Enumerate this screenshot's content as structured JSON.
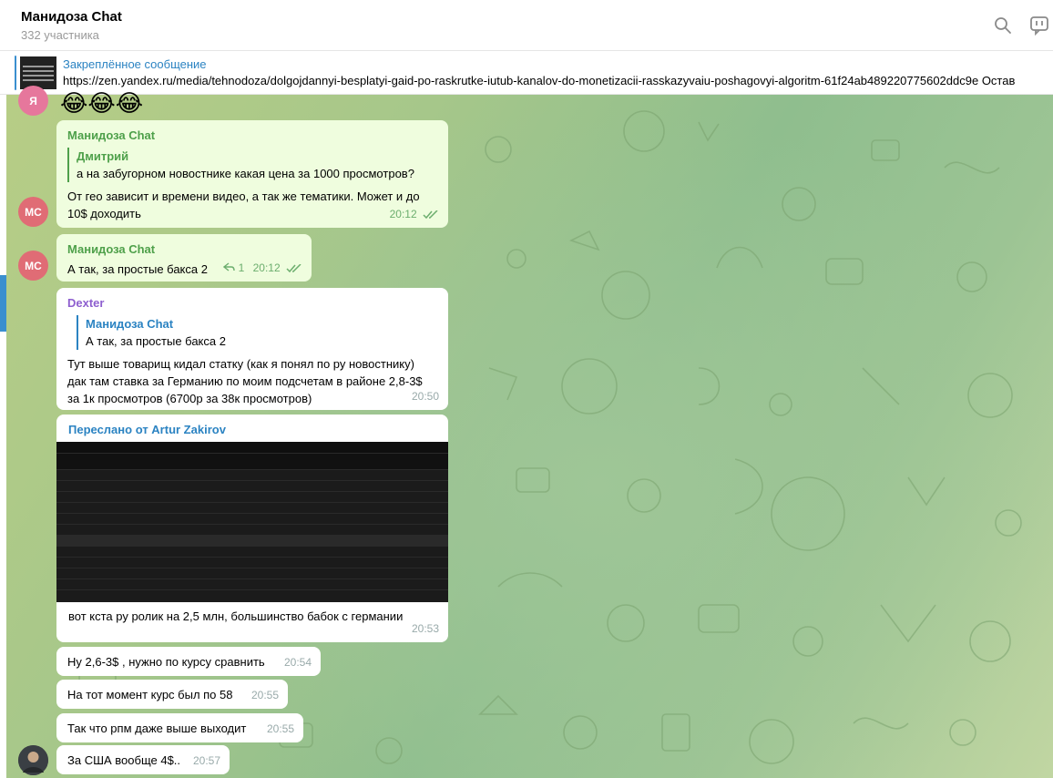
{
  "header": {
    "title": "Манидоза Chat",
    "members": "332 участника"
  },
  "pinned": {
    "title": "Закреплённое сообщение",
    "text": "https://zen.yandex.ru/media/tehnodoza/dolgojdannyi-besplatyi-gaid-po-raskrutke-iutub-kanalov-do-monetizacii-rasskazyvaiu-poshagovyi-algoritm-61f24ab489220775602ddc9e Остав"
  },
  "colors": {
    "accent": "#2b83c2",
    "sender_green": "#4ea04a",
    "sender_purple": "#8e5fcf",
    "avatar_red": "#e06c75",
    "outgoing_bubble": "#effdde"
  },
  "messages": {
    "top_avatar": "Я",
    "top_emoji": "😂😂😂",
    "m1": {
      "avatar": "МС",
      "sender": "Манидоза Chat",
      "reply_name": "Дмитрий",
      "reply_text": "а на забугорном новостнике какая цена за 1000 просмотров?",
      "text": "От гео зависит и времени видео, а так же тематики. Может и до 10$ доходить",
      "time": "20:12"
    },
    "m2": {
      "avatar": "МС",
      "sender": "Манидоза Chat",
      "text": "А так, за простые бакса 2",
      "replies": "1",
      "time": "20:12"
    },
    "m3": {
      "sender": "Dexter",
      "reply_name": "Манидоза Chat",
      "reply_text": "А так, за простые бакса 2",
      "text": "Тут выше товарищ кидал статку (как я понял по ру новостнику) дак там ставка за Германию по моим подсчетам в районе 2,8-3$ за 1к просмотров (6700р за 38к просмотров)",
      "time": "20:50"
    },
    "m4": {
      "forward_label": "Переслано от Artur Zakirov",
      "text": "вот кста ру ролик на 2,5 млн, большинство бабок с германии",
      "time": "20:53"
    },
    "m5": {
      "text": "Ну 2,6-3$ , нужно по курсу сравнить",
      "time": "20:54"
    },
    "m6": {
      "text": "На тот момент курс был по 58",
      "time": "20:55"
    },
    "m7": {
      "text": "Так что рпм даже выше выходит",
      "time": "20:55"
    },
    "m8": {
      "text": "За США вообще 4$..",
      "time": "20:57"
    }
  }
}
